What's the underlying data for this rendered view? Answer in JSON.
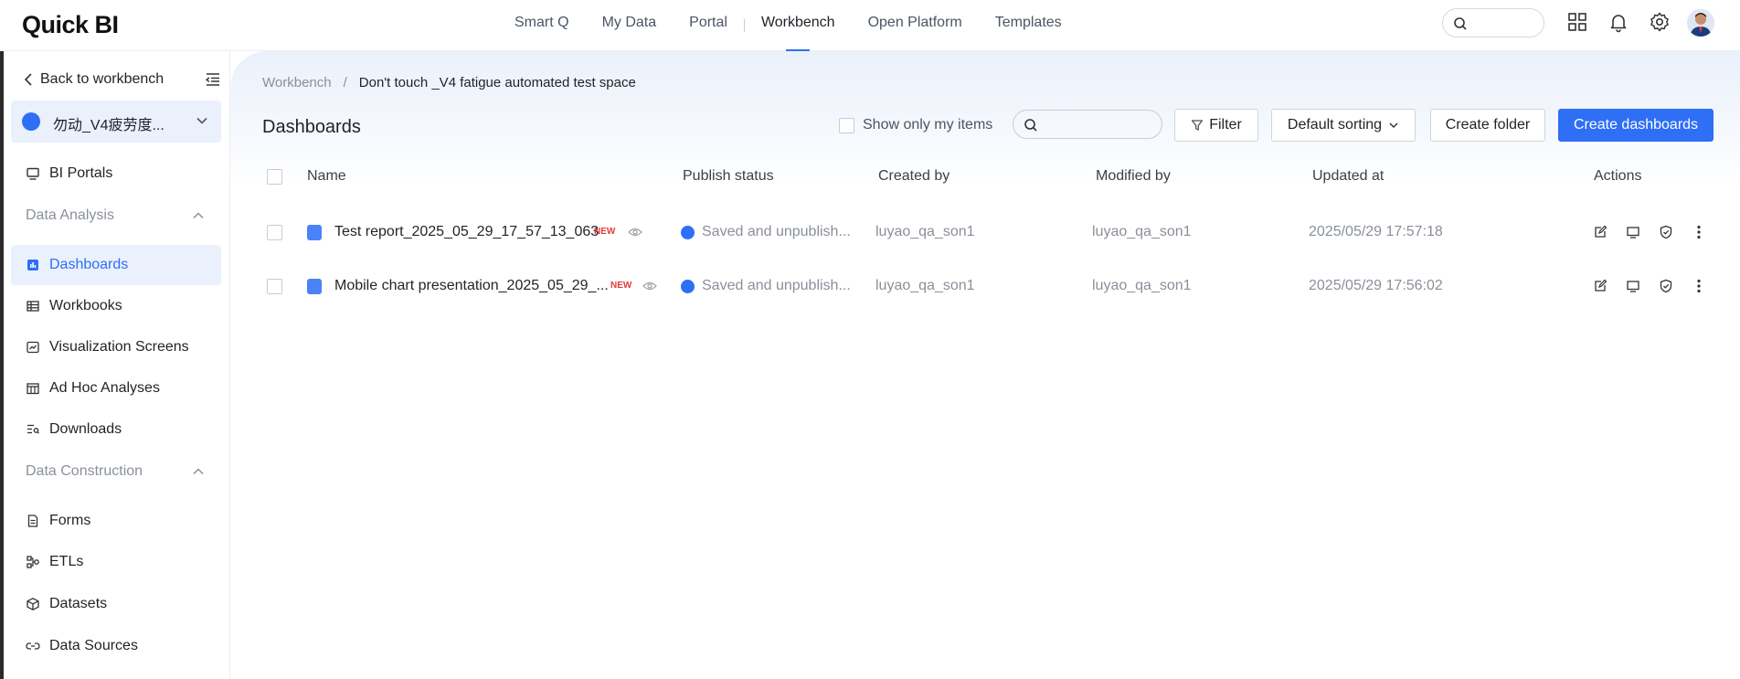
{
  "app": {
    "logo": "Quick BI"
  },
  "nav": {
    "items": [
      "Smart Q",
      "My Data",
      "Portal",
      "Workbench",
      "Open Platform",
      "Templates"
    ],
    "active": "Workbench"
  },
  "sidebar": {
    "back_label": "Back to workbench",
    "space_name": "勿动_V4疲劳度...",
    "portals_label": "BI Portals",
    "group_analysis": "Data Analysis",
    "analysis_items": [
      "Dashboards",
      "Workbooks",
      "Visualization Screens",
      "Ad Hoc Analyses",
      "Downloads"
    ],
    "group_construction": "Data Construction",
    "construction_items": [
      "Forms",
      "ETLs",
      "Datasets",
      "Data Sources"
    ]
  },
  "main": {
    "breadcrumb": {
      "root": "Workbench",
      "current": "Don't touch _V4 fatigue automated test space"
    },
    "title": "Dashboards",
    "only_mine_label": "Show only my items",
    "filter_label": "Filter",
    "sort_label": "Default sorting",
    "create_folder_label": "Create folder",
    "create_dashboard_label": "Create dashboards"
  },
  "table": {
    "columns": [
      "Name",
      "Publish status",
      "Created by",
      "Modified by",
      "Updated at",
      "Actions"
    ],
    "rows": [
      {
        "name": "Test report_2025_05_29_17_57_13_063",
        "tag": "NEW",
        "status": "Saved and unpublish...",
        "created_by": "luyao_qa_son1",
        "modified_by": "luyao_qa_son1",
        "updated_at": "2025/05/29 17:57:18"
      },
      {
        "name": "Mobile chart presentation_2025_05_29_...",
        "tag": "NEW",
        "status": "Saved and unpublish...",
        "created_by": "luyao_qa_son1",
        "modified_by": "luyao_qa_son1",
        "updated_at": "2025/05/29 17:56:02"
      }
    ]
  },
  "colors": {
    "accent": "#2e6ff6",
    "new_tag": "#e03b3b",
    "muted_text": "#8a9099"
  }
}
